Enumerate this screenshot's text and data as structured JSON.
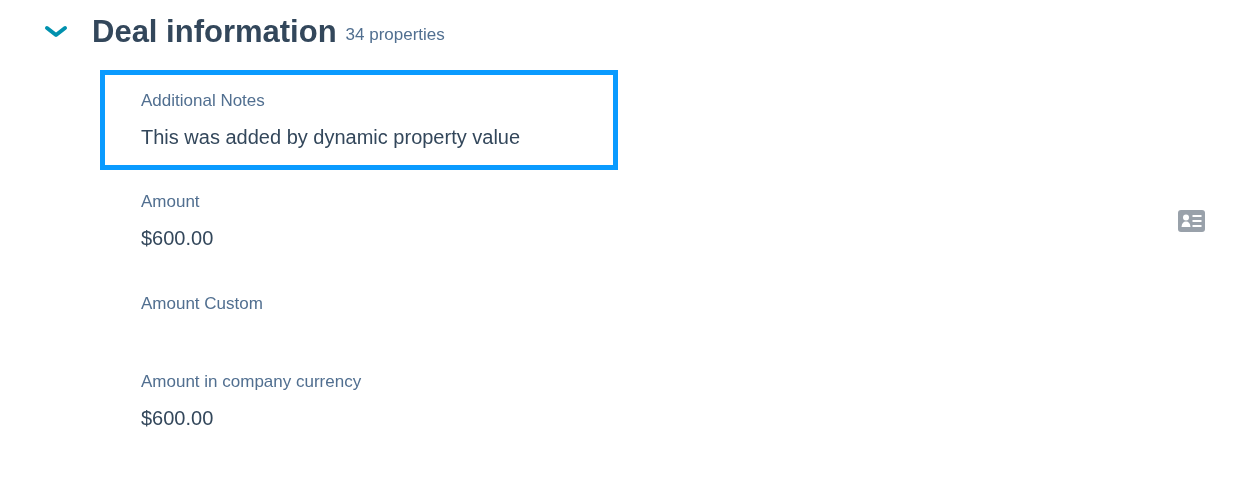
{
  "section": {
    "title": "Deal information",
    "count": "34 properties",
    "expanded": true
  },
  "properties": [
    {
      "label": "Additional Notes",
      "value": "This was added by dynamic property value",
      "highlighted": true,
      "has_card_icon": false
    },
    {
      "label": "Amount",
      "value": "$600.00",
      "highlighted": false,
      "has_card_icon": true
    },
    {
      "label": "Amount Custom",
      "highlighted": false,
      "has_card_icon": false
    },
    {
      "label": "Amount in company currency",
      "value": "$600.00",
      "highlighted": false,
      "has_card_icon": false
    }
  ]
}
